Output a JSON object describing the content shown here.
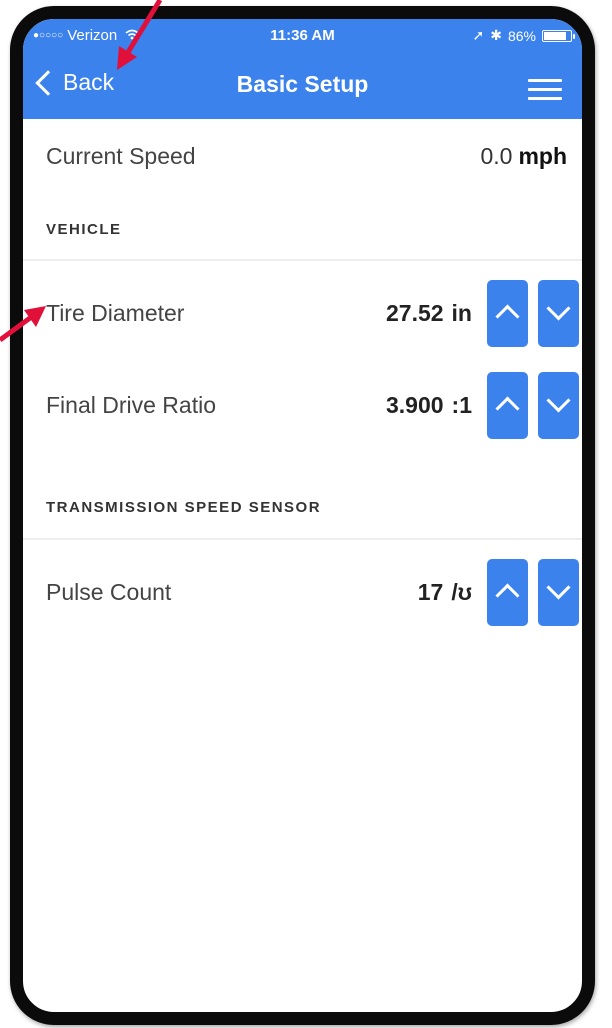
{
  "status_bar": {
    "signal": "●○○○○",
    "carrier": "Verizon",
    "time": "11:36 AM",
    "location_glyph": "➚",
    "bluetooth_glyph": "✱",
    "battery_percent": "86%",
    "battery_level": 0.86
  },
  "nav": {
    "back_label": "Back",
    "title": "Basic Setup"
  },
  "current_speed": {
    "label": "Current Speed",
    "value": "0.0",
    "unit": "mph"
  },
  "sections": {
    "vehicle": {
      "header": "VEHICLE",
      "tire_diameter": {
        "label": "Tire Diameter",
        "value": "27.52",
        "unit": "in"
      },
      "final_drive_ratio": {
        "label": "Final Drive Ratio",
        "value": "3.900",
        "unit": ":1"
      }
    },
    "transmission": {
      "header": "TRANSMISSION SPEED SENSOR",
      "pulse_count": {
        "label": "Pulse Count",
        "value": "17",
        "unit": "/ʊ"
      }
    }
  },
  "colors": {
    "accent": "#3b82ec",
    "annotation": "#e0103a"
  },
  "icons": {
    "back": "chevron-left-icon",
    "menu": "hamburger-menu-icon",
    "increment": "chevron-up-icon",
    "decrement": "chevron-down-icon"
  }
}
